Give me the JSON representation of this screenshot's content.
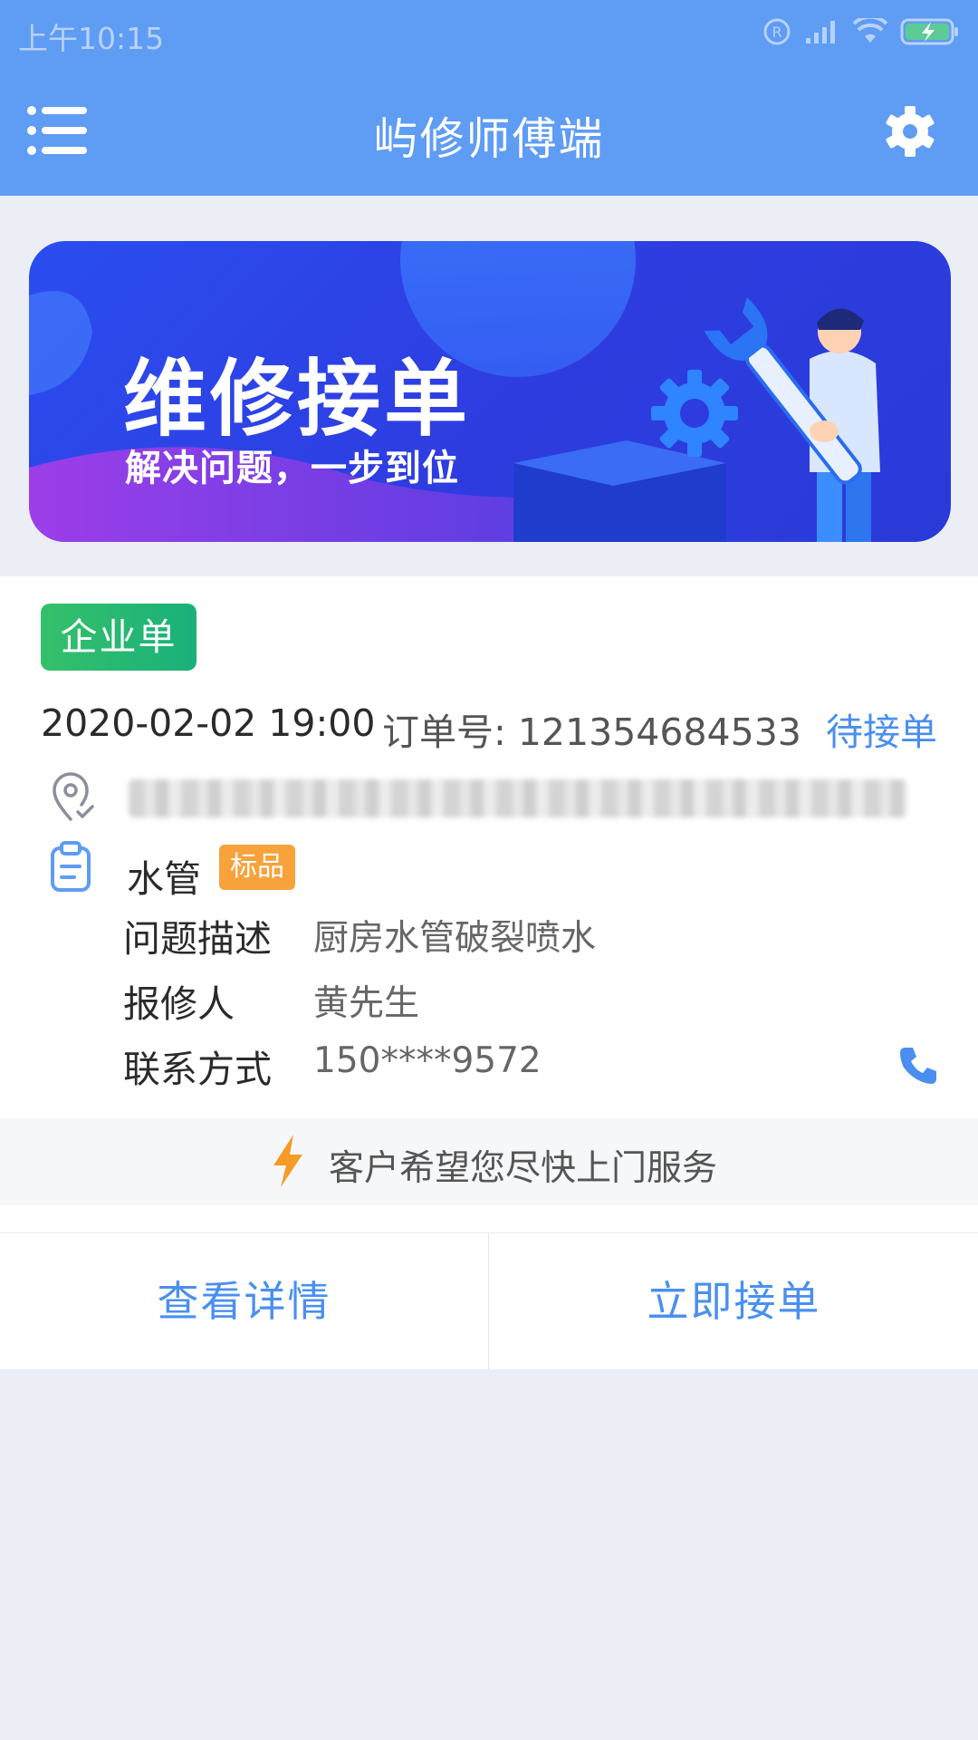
{
  "status_bar": {
    "time": "上午10:15"
  },
  "appbar": {
    "title": "屿修师傅端"
  },
  "banner": {
    "title": "维修接单",
    "subtitle": "解决问题，一步到位"
  },
  "order": {
    "type_badge": "企业单",
    "time": "2020-02-02 19:00",
    "order_no": "订单号: 121354684533",
    "status": "待接单",
    "address": "",
    "category": "水管",
    "category_tag": "标品",
    "fields": [
      {
        "label": "问题描述",
        "value": "厨房水管破裂喷水"
      },
      {
        "label": "报修人",
        "value": "黄先生"
      },
      {
        "label": "联系方式",
        "value": "150****9572"
      }
    ],
    "hint": "客户希望您尽快上门服务"
  },
  "actions": {
    "details": "查看详情",
    "accept": "立即接单"
  },
  "colors": {
    "primary": "#5f9cf4",
    "link": "#4a8ff0",
    "badge_green": "#2dbb6f",
    "tag_orange": "#f7a23b"
  }
}
